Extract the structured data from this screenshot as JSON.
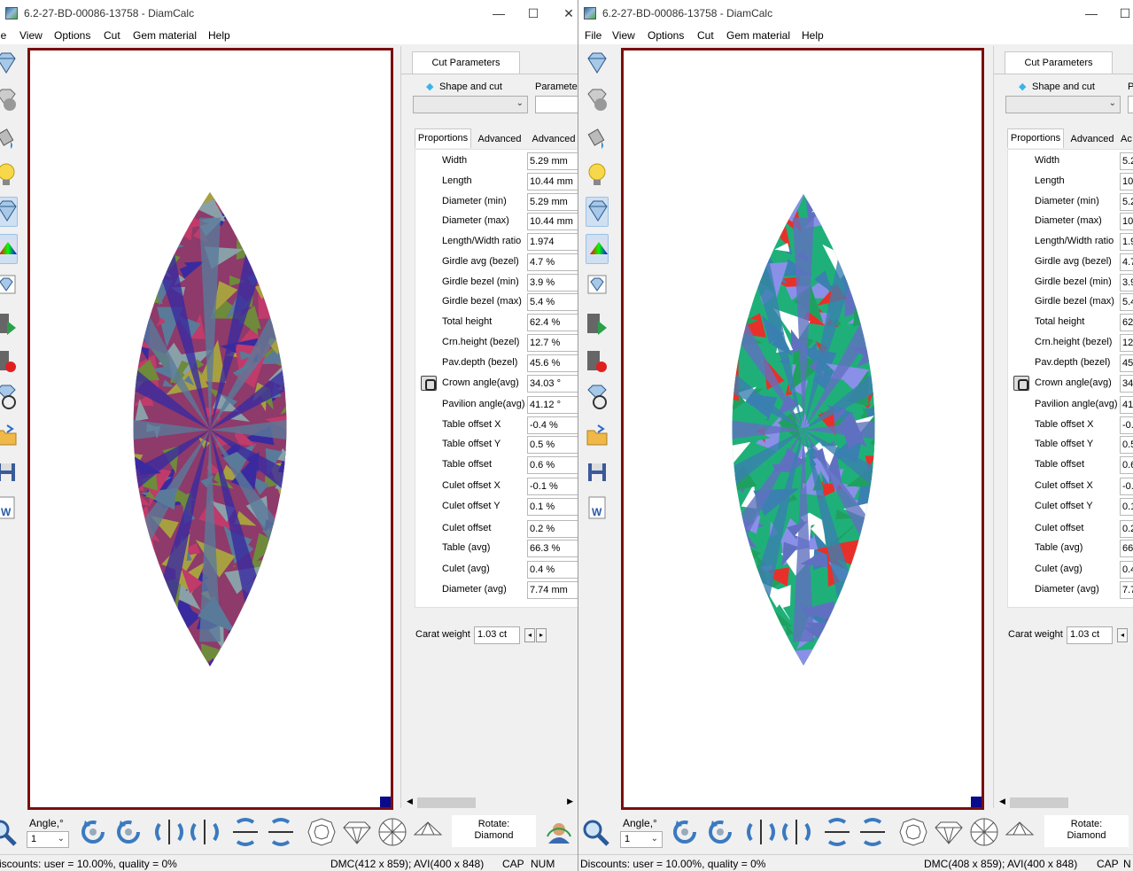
{
  "left": {
    "title": "6.2-27-BD-00086-13758 - DiamCalc",
    "menu": [
      "le",
      "View",
      "Options",
      "Cut",
      "Gem material",
      "Help"
    ],
    "cut_parameters_tab": "Cut Parameters",
    "shape_and_cut_label": "Shape and cut",
    "parameters_label": "Parameters",
    "subtabs": [
      "Proportions",
      "Advanced",
      "Advanced"
    ],
    "params": [
      {
        "label": "Width",
        "value": "5.29 mm"
      },
      {
        "label": "Length",
        "value": "10.44 mm"
      },
      {
        "label": "Diameter (min)",
        "value": "5.29 mm"
      },
      {
        "label": "Diameter (max)",
        "value": "10.44 mm"
      },
      {
        "label": "Length/Width ratio",
        "value": "1.974"
      },
      {
        "label": "Girdle avg (bezel)",
        "value": "4.7 %"
      },
      {
        "label": "Girdle bezel (min)",
        "value": "3.9 %"
      },
      {
        "label": "Girdle bezel (max)",
        "value": "5.4 %"
      },
      {
        "label": "Total height",
        "value": "62.4 %"
      },
      {
        "label": "Crn.height (bezel)",
        "value": "12.7 %"
      },
      {
        "label": "Pav.depth (bezel)",
        "value": "45.6 %"
      },
      {
        "label": "Crown angle(avg)",
        "value": "34.03 °"
      },
      {
        "label": "Pavilion angle(avg)",
        "value": "41.12 °"
      },
      {
        "label": "Table offset X",
        "value": "-0.4 %"
      },
      {
        "label": "Table offset Y",
        "value": "0.5 %"
      },
      {
        "label": "Table offset",
        "value": "0.6 %"
      },
      {
        "label": "Culet offset X",
        "value": "-0.1 %"
      },
      {
        "label": "Culet offset Y",
        "value": "0.1 %"
      },
      {
        "label": "Culet offset",
        "value": "0.2 %"
      },
      {
        "label": "Table (avg)",
        "value": "66.3 %"
      },
      {
        "label": "Culet (avg)",
        "value": "0.4 %"
      },
      {
        "label": "Diameter (avg)",
        "value": "7.74 mm"
      }
    ],
    "carat_label": "Carat weight",
    "carat_value": "1.03 ct",
    "angle_label": "Angle,°",
    "angle_value": "1",
    "rotate_label": "Rotate:",
    "rotate_value": "Diamond",
    "status_discounts": "iscounts: user = 10.00%, quality = 0%",
    "status_dims": "DMC(412 x 859); AVI(400 x 848)",
    "status_cap": "CAP",
    "status_num": "NUM"
  },
  "right": {
    "title": "6.2-27-BD-00086-13758 - DiamCalc",
    "menu": [
      "File",
      "View",
      "Options",
      "Cut",
      "Gem material",
      "Help"
    ],
    "cut_parameters_tab": "Cut Parameters",
    "shape_and_cut_label": "Shape and cut",
    "parameters_label": "P",
    "subtabs": [
      "Proportions",
      "Advanced",
      "Ac"
    ],
    "params": [
      {
        "label": "Width",
        "value": "5.2"
      },
      {
        "label": "Length",
        "value": "10"
      },
      {
        "label": "Diameter (min)",
        "value": "5.2"
      },
      {
        "label": "Diameter (max)",
        "value": "10"
      },
      {
        "label": "Length/Width ratio",
        "value": "1.9"
      },
      {
        "label": "Girdle avg (bezel)",
        "value": "4.7"
      },
      {
        "label": "Girdle bezel (min)",
        "value": "3.9"
      },
      {
        "label": "Girdle bezel (max)",
        "value": "5.4"
      },
      {
        "label": "Total height",
        "value": "62"
      },
      {
        "label": "Crn.height (bezel)",
        "value": "12"
      },
      {
        "label": "Pav.depth (bezel)",
        "value": "45"
      },
      {
        "label": "Crown angle(avg)",
        "value": "34"
      },
      {
        "label": "Pavilion angle(avg)",
        "value": "41"
      },
      {
        "label": "Table offset X",
        "value": "-0."
      },
      {
        "label": "Table offset Y",
        "value": "0.5"
      },
      {
        "label": "Table offset",
        "value": "0.6"
      },
      {
        "label": "Culet offset X",
        "value": "-0."
      },
      {
        "label": "Culet offset Y",
        "value": "0.1"
      },
      {
        "label": "Culet offset",
        "value": "0.2"
      },
      {
        "label": "Table (avg)",
        "value": "66"
      },
      {
        "label": "Culet (avg)",
        "value": "0.4"
      },
      {
        "label": "Diameter (avg)",
        "value": "7.7"
      }
    ],
    "carat_label": "Carat weight",
    "carat_value": "1.03 ct",
    "angle_label": "Angle,°",
    "angle_value": "1",
    "rotate_label": "Rotate:",
    "rotate_value": "Diamond",
    "status_discounts": "Discounts: user = 10.00%, quality = 0%",
    "status_dims": "DMC(408 x 859); AVI(400 x 848)",
    "status_cap": "CAP",
    "status_num": "N"
  },
  "colors": {
    "frame": "#7a0e0e",
    "corner": "#0a0a8c",
    "stone_left": [
      "#8e3a6a",
      "#6e8a3a",
      "#3a2aa0",
      "#c03a6a",
      "#8aa0a8",
      "#a8a040",
      "#5a7a9a"
    ],
    "stone_right": [
      "#1fb07a",
      "#ffffff",
      "#3a80b0",
      "#e8302a",
      "#8a90e8",
      "#20a060",
      "#6070c0"
    ]
  }
}
